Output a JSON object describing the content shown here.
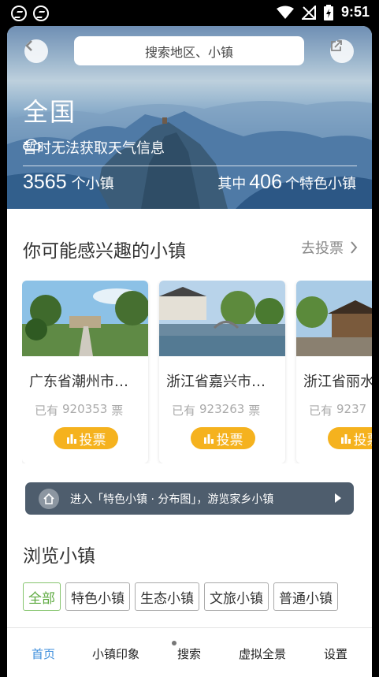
{
  "status_bar": {
    "time": "9:51",
    "icons": [
      "app-notification-icon",
      "app-notification-icon",
      "wifi-icon",
      "no-signal-icon",
      "battery-charging-icon"
    ]
  },
  "header": {
    "search_placeholder": "搜索地区、小镇",
    "back_icon": "chevron-left-icon",
    "share_icon": "share-icon"
  },
  "hero": {
    "region": "全国",
    "weather_text": "暂时无法获取天气信息",
    "total_count": "3565",
    "total_suffix": "个小镇",
    "featured_prefix": "其中",
    "featured_count": "406",
    "featured_suffix": "个特色小镇"
  },
  "interest_section": {
    "title": "你可能感兴趣的小镇",
    "vote_link": "去投票"
  },
  "cards": [
    {
      "name": "广东省潮州市…",
      "votes_prefix": "已有",
      "votes": "920353",
      "votes_suffix": "票",
      "button": "投票"
    },
    {
      "name": "浙江省嘉兴市…",
      "votes_prefix": "已有",
      "votes": "923263",
      "votes_suffix": "票",
      "button": "投票"
    },
    {
      "name": "浙江省丽水",
      "votes_prefix": "已有",
      "votes": "9237",
      "votes_suffix": "",
      "button": "投票"
    }
  ],
  "banner": {
    "text": "进入「特色小镇 · 分布图」，游览家乡小镇"
  },
  "browse": {
    "title": "浏览小镇",
    "filters": [
      "全部",
      "特色小镇",
      "生态小镇",
      "文旅小镇",
      "普通小镇"
    ],
    "active_filter": "全部"
  },
  "bottom_nav": {
    "items": [
      "首页",
      "小镇印象",
      "搜索",
      "虚拟全景",
      "设置"
    ],
    "active": "首页"
  },
  "colors": {
    "accent_blue": "#3f8fdc",
    "vote_yellow": "#f5b21e",
    "filter_green": "#5daa40",
    "banner_bg": "#4e5d6d"
  }
}
